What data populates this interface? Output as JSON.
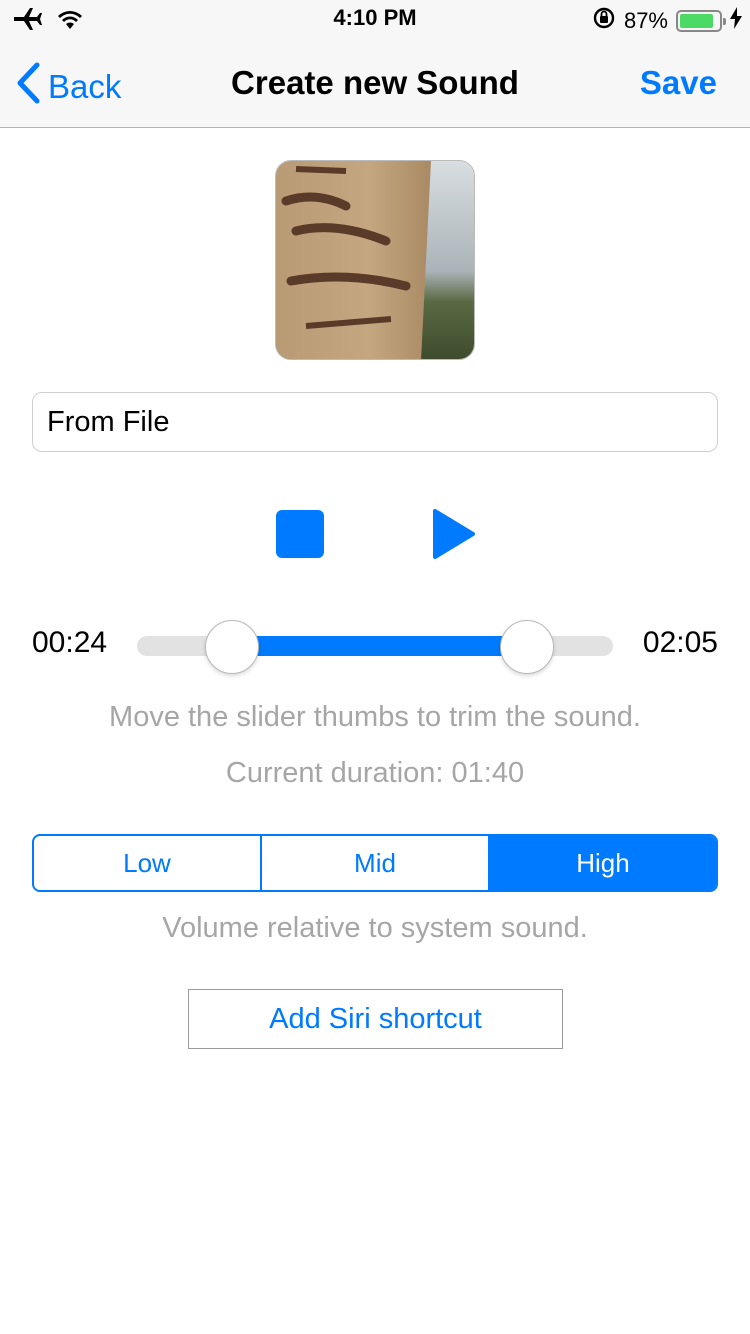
{
  "status_bar": {
    "time": "4:10 PM",
    "battery_percent": "87%",
    "battery_level": 0.87,
    "icons": [
      "airplane-icon",
      "wifi-icon",
      "orientation-lock-icon",
      "battery-icon",
      "charging-bolt-icon"
    ]
  },
  "nav": {
    "back_label": "Back",
    "title": "Create new Sound",
    "save_label": "Save"
  },
  "sound": {
    "name_value": "From File"
  },
  "player": {
    "stop_icon": "stop-icon",
    "play_icon": "play-icon"
  },
  "trim": {
    "start_label": "00:24",
    "end_label": "02:05",
    "start_fraction": 0.2,
    "end_fraction": 0.82,
    "hint": "Move the slider thumbs to trim the sound.",
    "duration_text": "Current duration: 01:40"
  },
  "volume": {
    "options": [
      "Low",
      "Mid",
      "High"
    ],
    "selected": "High",
    "hint": "Volume relative to system sound."
  },
  "siri_button_label": "Add Siri shortcut",
  "colors": {
    "accent": "#007aff",
    "battery": "#4cd964",
    "hint_text": "#a6a6a6"
  }
}
